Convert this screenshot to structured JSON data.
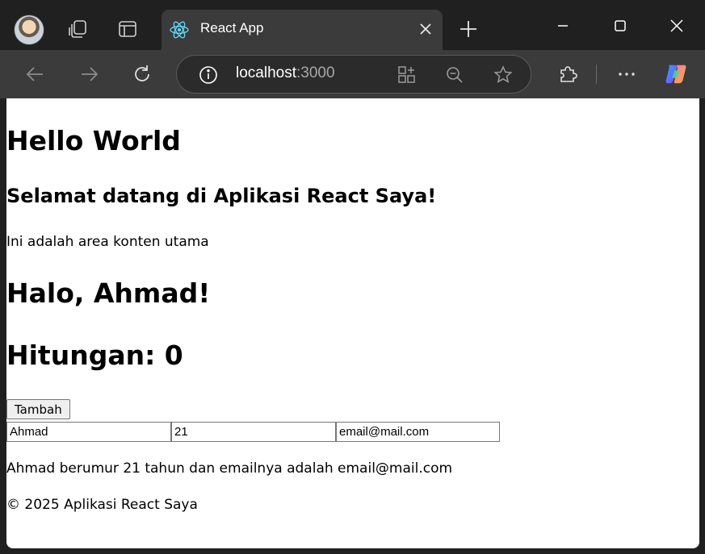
{
  "browser": {
    "tab": {
      "title": "React App",
      "favicon": "react-icon"
    },
    "url": {
      "host": "localhost",
      "port": ":3000"
    },
    "icons": {
      "workspaces": "workspaces-icon",
      "tab_actions": "tab-actions-icon",
      "new_tab": "plus-icon",
      "back": "arrow-left-icon",
      "forward": "arrow-right-icon",
      "refresh": "refresh-icon",
      "site_info": "info-icon",
      "app_available": "app-install-icon",
      "zoom": "zoom-out-icon",
      "favorite": "star-icon",
      "extensions": "puzzle-icon",
      "more": "more-icon",
      "copilot": "copilot-icon"
    }
  },
  "page": {
    "heading": "Hello World",
    "subheading": "Selamat datang di Aplikasi React Saya!",
    "main_text": "Ini adalah area konten utama",
    "greeting": "Halo, Ahmad!",
    "counter": "Hitungan: 0",
    "add_button": "Tambah",
    "inputs": {
      "name": "Ahmad",
      "age": "21",
      "email": "email@mail.com"
    },
    "summary": "Ahmad berumur 21 tahun dan emailnya adalah email@mail.com",
    "footer": "© 2025 Aplikasi React Saya"
  }
}
